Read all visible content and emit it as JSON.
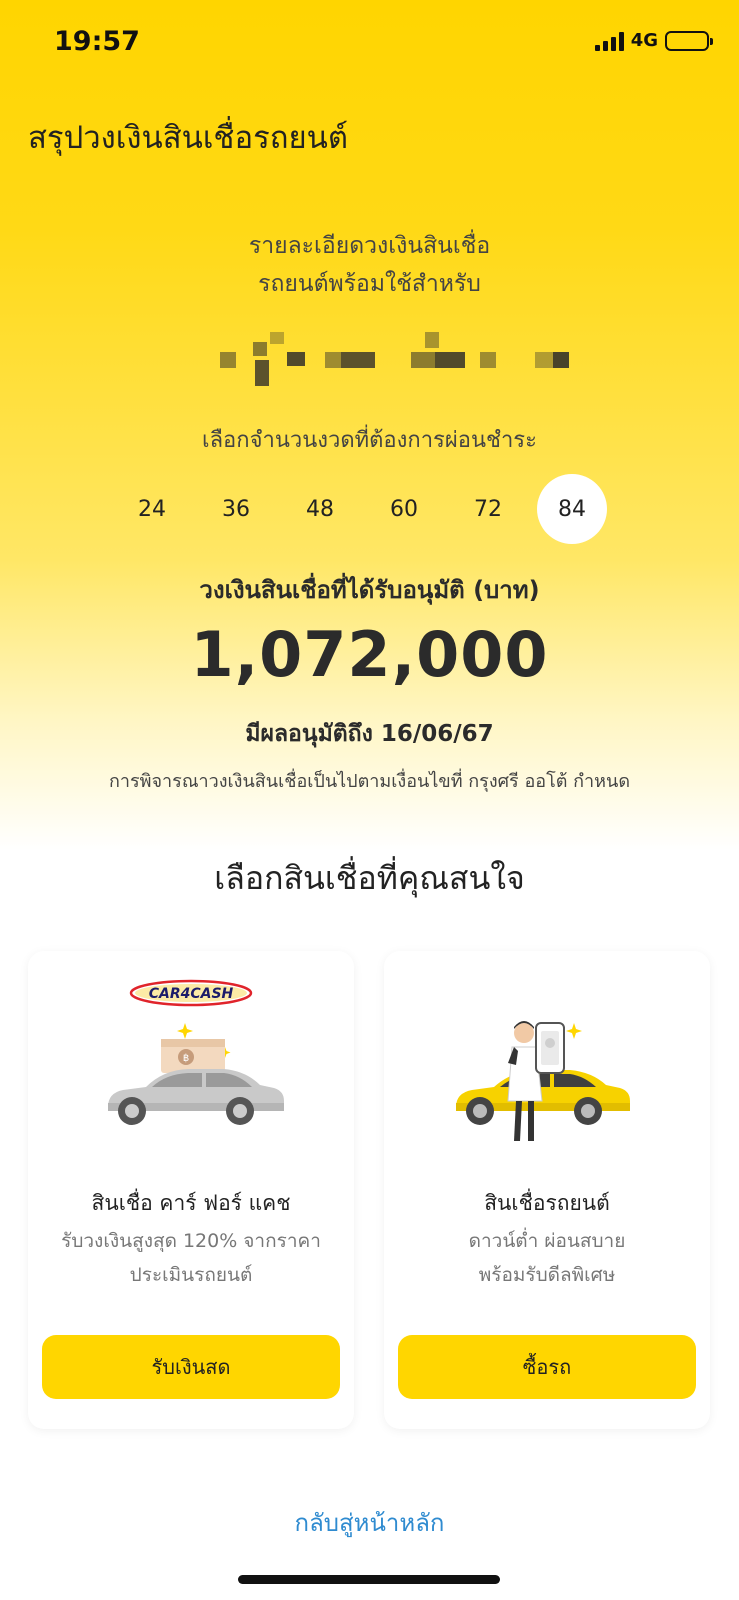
{
  "status_bar": {
    "time": "19:57",
    "network": "4G"
  },
  "page_title": "สรุปวงเงินสินเชื่อรถยนต์",
  "detail_lines": [
    "รายละเอียดวงเงินสินเชื่อ",
    "รถยนต์พร้อมใช้สำหรับ"
  ],
  "term_prompt": "เลือกจำนวนงวดที่ต้องการผ่อนชำระ",
  "terms": [
    "24",
    "36",
    "48",
    "60",
    "72",
    "84"
  ],
  "selected_term": "84",
  "approved_label": "วงเงินสินเชื่อที่ได้รับอนุมัติ (บาท)",
  "approved_amount": "1,072,000",
  "valid_until": "มีผลอนุมัติถึง 16/06/67",
  "condition_note": "การพิจารณาวงเงินสินเชื่อเป็นไปตามเงื่อนไขที่ กรุงศรี ออโต้ กำหนด",
  "choose_heading": "เลือกสินเชื่อที่คุณสนใจ",
  "cards": [
    {
      "logo_text": "CAR4CASH",
      "title": "สินเชื่อ คาร์ ฟอร์ แคช",
      "desc_lines": [
        "รับวงเงินสูงสุด 120% จากราคา",
        "ประเมินรถยนต์"
      ],
      "button": "รับเงินสด"
    },
    {
      "title": "สินเชื่อรถยนต์",
      "desc_lines": [
        "ดาวน์ต่ำ ผ่อนสบาย",
        "พร้อมรับดีลพิเศษ"
      ],
      "button": "ซื้อรถ"
    }
  ],
  "back_link": "กลับสู่หน้าหลัก",
  "colors": {
    "brand_yellow": "#ffd600",
    "link_blue": "#2f8bd0",
    "text_dark": "#2b2b2b"
  }
}
